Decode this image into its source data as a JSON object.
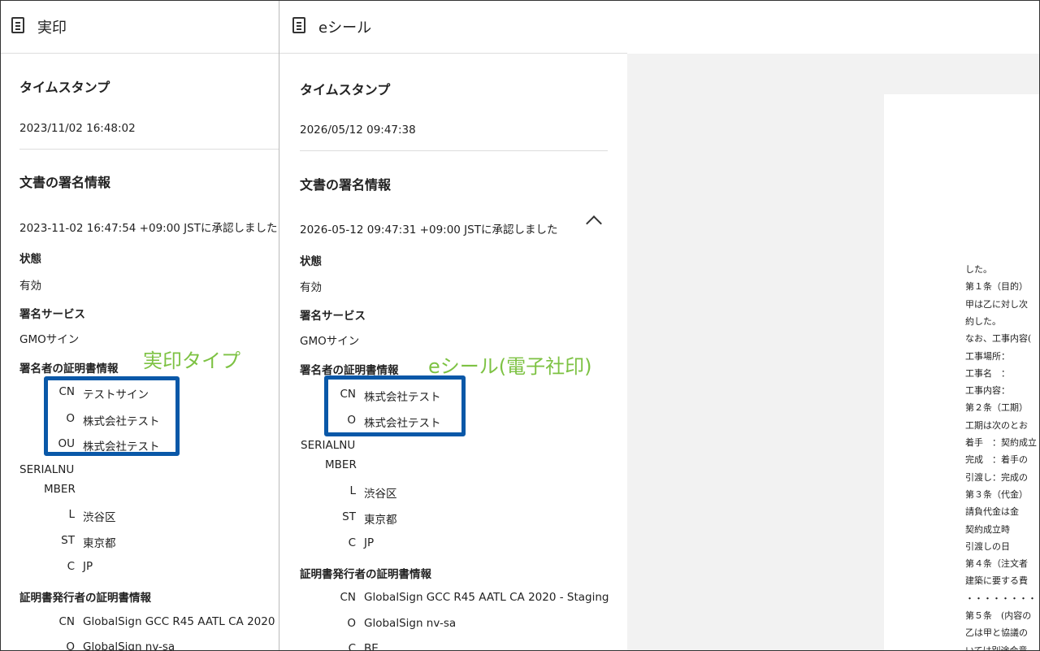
{
  "left": {
    "title": "実印",
    "timestamp_label": "タイムスタンプ",
    "timestamp": "2023/11/02 16:48:02",
    "sig_heading": "文書の署名情報",
    "approval": "2023-11-02 16:47:54 +09:00 JSTに承認しました",
    "state_label": "状態",
    "state_value": "有効",
    "service_label": "署名サービス",
    "service_value": "GMOサイン",
    "signer_label": "署名者の証明書情報",
    "cn_key": "CN",
    "cn": "テストサイン",
    "o_key": "O",
    "o": "株式会社テスト",
    "ou_key": "OU",
    "ou": "株式会社テスト",
    "serial_key_1": "SERIALNU",
    "serial_key_2": "MBER",
    "l_key": "L",
    "l": "渋谷区",
    "st_key": "ST",
    "st": "東京都",
    "c_key": "C",
    "c": "JP",
    "issuer_label": "証明書発行者の証明書情報",
    "icn_key": "CN",
    "icn": "GlobalSign GCC R45 AATL CA 2020",
    "io_key": "O",
    "io": "GlobalSign nv-sa"
  },
  "right": {
    "title": "eシール",
    "timestamp_label": "タイムスタンプ",
    "timestamp": "2026/05/12 09:47:38",
    "sig_heading": "文書の署名情報",
    "approval": "2026-05-12 09:47:31 +09:00 JSTに承認しました",
    "state_label": "状態",
    "state_value": "有効",
    "service_label": "署名サービス",
    "service_value": "GMOサイン",
    "signer_label": "署名者の証明書情報",
    "cn_key": "CN",
    "cn": "株式会社テスト",
    "o_key": "O",
    "o": "株式会社テスト",
    "serial_key_1": "SERIALNU",
    "serial_key_2": "MBER",
    "l_key": "L",
    "l": "渋谷区",
    "st_key": "ST",
    "st": "東京都",
    "c_key": "C",
    "c": "JP",
    "issuer_label": "証明書発行者の証明書情報",
    "icn_key": "CN",
    "icn": "GlobalSign GCC R45 AATL CA 2020 - Staging",
    "io_key": "O",
    "io": "GlobalSign nv-sa",
    "ic_key": "C",
    "ic": "BE"
  },
  "annotations": {
    "left": "実印タイプ",
    "right": "eシール(電子社印)",
    "box_color": "#0a58a8",
    "text_color": "#7dc243"
  },
  "document": {
    "lines": [
      "した。",
      "第１条（目的）",
      "甲は乙に対し次",
      "約した。",
      "なお、工事内容(",
      "工事場所：",
      "工事名　：",
      "工事内容：",
      "第２条（工期）",
      "工期は次のとお",
      "着手　：契約成立",
      "完成　：着手の",
      "引渡し：完成の",
      "第３条（代金）",
      "請負代金は金",
      "契約成立時",
      "引渡しの日",
      "第４条（注文者",
      "建築に要する費",
      "・・・・・・・・・・・・",
      "第５条　(内容の",
      "乙は甲と協議の",
      "いては別途合意"
    ]
  }
}
